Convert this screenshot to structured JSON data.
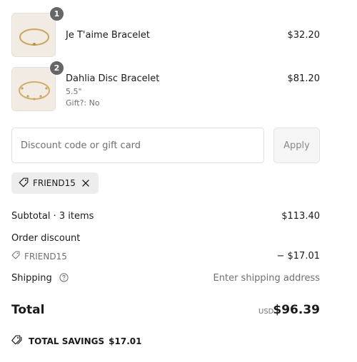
{
  "items": [
    {
      "quantity": "1",
      "name": "Je T'aime Bracelet",
      "price": "$32.20",
      "meta": []
    },
    {
      "quantity": "2",
      "name": "Dahlia Disc Bracelet",
      "price": "$81.20",
      "meta": [
        "5.5\"",
        "Gift?: No"
      ]
    }
  ],
  "discount": {
    "placeholder": "Discount code or gift card",
    "apply_label": "Apply",
    "applied_code": "FRIEND15"
  },
  "summary": {
    "subtotal_label": "Subtotal · 3 items",
    "subtotal_value": "$113.40",
    "order_discount_label": "Order discount",
    "discount_code": "FRIEND15",
    "discount_value": "− $17.01",
    "shipping_label": "Shipping",
    "shipping_value": "Enter shipping address",
    "total_label": "Total",
    "currency": "USD",
    "total_value": "$96.39"
  },
  "savings": {
    "label": "TOTAL SAVINGS",
    "amount": "$17.01"
  },
  "icons": {
    "tag": "tag-icon",
    "remove": "close-icon",
    "help": "help-circle-icon"
  },
  "colors": {
    "badge": "#666666",
    "chip_background": "#ededed",
    "muted_text": "#707070",
    "apply_button_bg": "#f5f5f5"
  }
}
